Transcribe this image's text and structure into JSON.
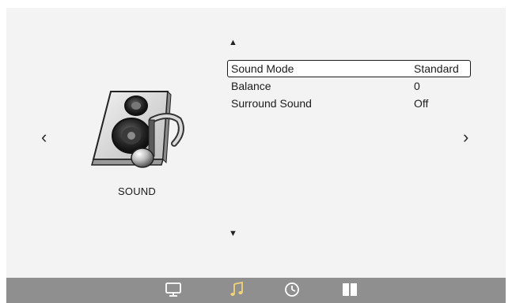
{
  "navigation": {
    "prev_glyph": "‹",
    "next_glyph": "›"
  },
  "category": {
    "label": "SOUND",
    "icon": "speaker-music-note-icon"
  },
  "scroll": {
    "up_glyph": "▲",
    "down_glyph": "▼"
  },
  "menu": {
    "items": [
      {
        "label": "Sound Mode",
        "value": "Standard",
        "selected": true
      },
      {
        "label": "Balance",
        "value": "0",
        "selected": false
      },
      {
        "label": "Surround Sound",
        "value": "Off",
        "selected": false
      }
    ]
  },
  "tabs": [
    {
      "icon": "monitor-icon",
      "active": false
    },
    {
      "icon": "music-note-icon",
      "active": true
    },
    {
      "icon": "clock-icon",
      "active": false
    },
    {
      "icon": "split-panel-icon",
      "active": false
    }
  ],
  "colors": {
    "panel": "#f3f3f3",
    "bottom_bar": "#8f8f8f",
    "tab_icon": "#ffffff",
    "active_tab_icon": "#f2d27a",
    "text": "#1c1c1c"
  }
}
